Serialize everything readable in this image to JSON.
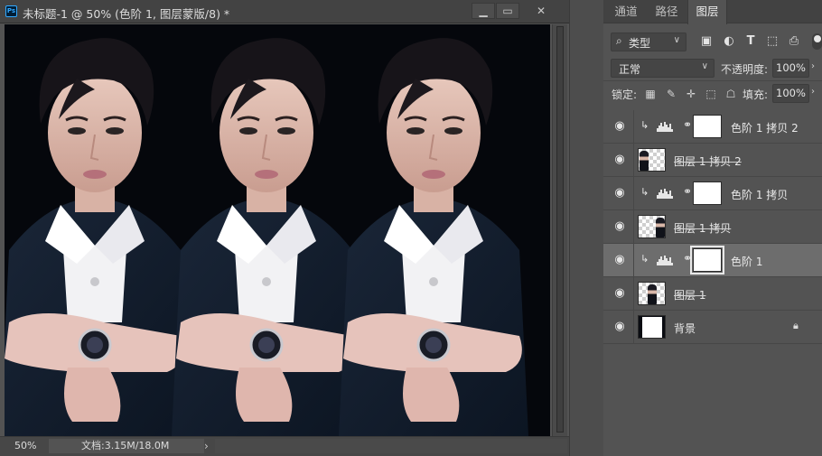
{
  "document": {
    "app_icon_text": "Ps",
    "title": "未标题-1 @ 50% (色阶 1, 图层蒙版/8) *",
    "controls": {
      "minimize": "▁",
      "maximize": "▭",
      "close": "✕"
    },
    "status": {
      "zoom": "50%",
      "doc_size": "文档:3.15M/18.0M",
      "arrow": "›"
    }
  },
  "panel": {
    "tabs": [
      "通道",
      "路径",
      "图层"
    ],
    "active_tab": "图层",
    "filter": {
      "label": "类型",
      "icons": [
        "image-filter-icon",
        "adjustment-filter-icon",
        "type-filter-icon",
        "shape-filter-icon",
        "smart-object-filter-icon"
      ]
    },
    "blend_mode": "正常",
    "opacity_label": "不透明度:",
    "opacity_value": "100%",
    "lock_label": "锁定:",
    "fill_label": "填充:",
    "fill_value": "100%",
    "layers": [
      {
        "name": "色阶 1 拷贝 2",
        "kind": "adjustment",
        "clipped": true,
        "hidden_strike": false,
        "selected": false
      },
      {
        "name": "图层 1 拷贝 2",
        "kind": "pixel",
        "strike": true,
        "figure_pos": "left",
        "selected": false
      },
      {
        "name": "色阶 1 拷贝",
        "kind": "adjustment",
        "clipped": true,
        "selected": false
      },
      {
        "name": "图层 1 拷贝",
        "kind": "pixel",
        "strike": true,
        "figure_pos": "right",
        "selected": false
      },
      {
        "name": "色阶 1",
        "kind": "adjustment",
        "clipped": true,
        "selected": true
      },
      {
        "name": "图层 1",
        "kind": "pixel",
        "strike": true,
        "figure_pos": "center",
        "selected": false
      },
      {
        "name": "背景",
        "kind": "background",
        "locked": true,
        "selected": false
      }
    ]
  },
  "colors": {
    "workspace": "#535353",
    "titlebar": "#434343",
    "selected_layer": "#6d6d6d",
    "canvas_bg": "#05070c"
  }
}
